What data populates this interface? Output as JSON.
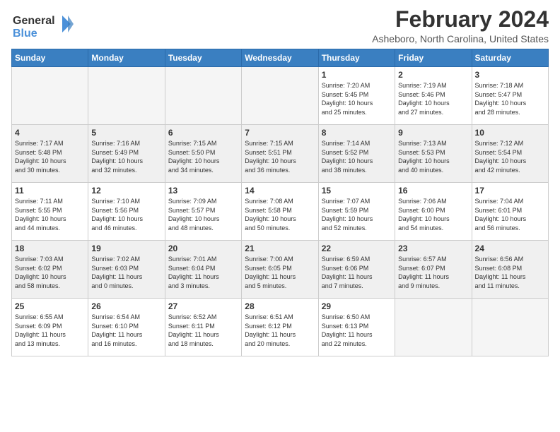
{
  "logo": {
    "line1": "General",
    "line2": "Blue"
  },
  "title": "February 2024",
  "location": "Asheboro, North Carolina, United States",
  "days_of_week": [
    "Sunday",
    "Monday",
    "Tuesday",
    "Wednesday",
    "Thursday",
    "Friday",
    "Saturday"
  ],
  "weeks": [
    [
      {
        "day": "",
        "info": ""
      },
      {
        "day": "",
        "info": ""
      },
      {
        "day": "",
        "info": ""
      },
      {
        "day": "",
        "info": ""
      },
      {
        "day": "1",
        "info": "Sunrise: 7:20 AM\nSunset: 5:45 PM\nDaylight: 10 hours\nand 25 minutes."
      },
      {
        "day": "2",
        "info": "Sunrise: 7:19 AM\nSunset: 5:46 PM\nDaylight: 10 hours\nand 27 minutes."
      },
      {
        "day": "3",
        "info": "Sunrise: 7:18 AM\nSunset: 5:47 PM\nDaylight: 10 hours\nand 28 minutes."
      }
    ],
    [
      {
        "day": "4",
        "info": "Sunrise: 7:17 AM\nSunset: 5:48 PM\nDaylight: 10 hours\nand 30 minutes."
      },
      {
        "day": "5",
        "info": "Sunrise: 7:16 AM\nSunset: 5:49 PM\nDaylight: 10 hours\nand 32 minutes."
      },
      {
        "day": "6",
        "info": "Sunrise: 7:15 AM\nSunset: 5:50 PM\nDaylight: 10 hours\nand 34 minutes."
      },
      {
        "day": "7",
        "info": "Sunrise: 7:15 AM\nSunset: 5:51 PM\nDaylight: 10 hours\nand 36 minutes."
      },
      {
        "day": "8",
        "info": "Sunrise: 7:14 AM\nSunset: 5:52 PM\nDaylight: 10 hours\nand 38 minutes."
      },
      {
        "day": "9",
        "info": "Sunrise: 7:13 AM\nSunset: 5:53 PM\nDaylight: 10 hours\nand 40 minutes."
      },
      {
        "day": "10",
        "info": "Sunrise: 7:12 AM\nSunset: 5:54 PM\nDaylight: 10 hours\nand 42 minutes."
      }
    ],
    [
      {
        "day": "11",
        "info": "Sunrise: 7:11 AM\nSunset: 5:55 PM\nDaylight: 10 hours\nand 44 minutes."
      },
      {
        "day": "12",
        "info": "Sunrise: 7:10 AM\nSunset: 5:56 PM\nDaylight: 10 hours\nand 46 minutes."
      },
      {
        "day": "13",
        "info": "Sunrise: 7:09 AM\nSunset: 5:57 PM\nDaylight: 10 hours\nand 48 minutes."
      },
      {
        "day": "14",
        "info": "Sunrise: 7:08 AM\nSunset: 5:58 PM\nDaylight: 10 hours\nand 50 minutes."
      },
      {
        "day": "15",
        "info": "Sunrise: 7:07 AM\nSunset: 5:59 PM\nDaylight: 10 hours\nand 52 minutes."
      },
      {
        "day": "16",
        "info": "Sunrise: 7:06 AM\nSunset: 6:00 PM\nDaylight: 10 hours\nand 54 minutes."
      },
      {
        "day": "17",
        "info": "Sunrise: 7:04 AM\nSunset: 6:01 PM\nDaylight: 10 hours\nand 56 minutes."
      }
    ],
    [
      {
        "day": "18",
        "info": "Sunrise: 7:03 AM\nSunset: 6:02 PM\nDaylight: 10 hours\nand 58 minutes."
      },
      {
        "day": "19",
        "info": "Sunrise: 7:02 AM\nSunset: 6:03 PM\nDaylight: 11 hours\nand 0 minutes."
      },
      {
        "day": "20",
        "info": "Sunrise: 7:01 AM\nSunset: 6:04 PM\nDaylight: 11 hours\nand 3 minutes."
      },
      {
        "day": "21",
        "info": "Sunrise: 7:00 AM\nSunset: 6:05 PM\nDaylight: 11 hours\nand 5 minutes."
      },
      {
        "day": "22",
        "info": "Sunrise: 6:59 AM\nSunset: 6:06 PM\nDaylight: 11 hours\nand 7 minutes."
      },
      {
        "day": "23",
        "info": "Sunrise: 6:57 AM\nSunset: 6:07 PM\nDaylight: 11 hours\nand 9 minutes."
      },
      {
        "day": "24",
        "info": "Sunrise: 6:56 AM\nSunset: 6:08 PM\nDaylight: 11 hours\nand 11 minutes."
      }
    ],
    [
      {
        "day": "25",
        "info": "Sunrise: 6:55 AM\nSunset: 6:09 PM\nDaylight: 11 hours\nand 13 minutes."
      },
      {
        "day": "26",
        "info": "Sunrise: 6:54 AM\nSunset: 6:10 PM\nDaylight: 11 hours\nand 16 minutes."
      },
      {
        "day": "27",
        "info": "Sunrise: 6:52 AM\nSunset: 6:11 PM\nDaylight: 11 hours\nand 18 minutes."
      },
      {
        "day": "28",
        "info": "Sunrise: 6:51 AM\nSunset: 6:12 PM\nDaylight: 11 hours\nand 20 minutes."
      },
      {
        "day": "29",
        "info": "Sunrise: 6:50 AM\nSunset: 6:13 PM\nDaylight: 11 hours\nand 22 minutes."
      },
      {
        "day": "",
        "info": ""
      },
      {
        "day": "",
        "info": ""
      }
    ]
  ]
}
